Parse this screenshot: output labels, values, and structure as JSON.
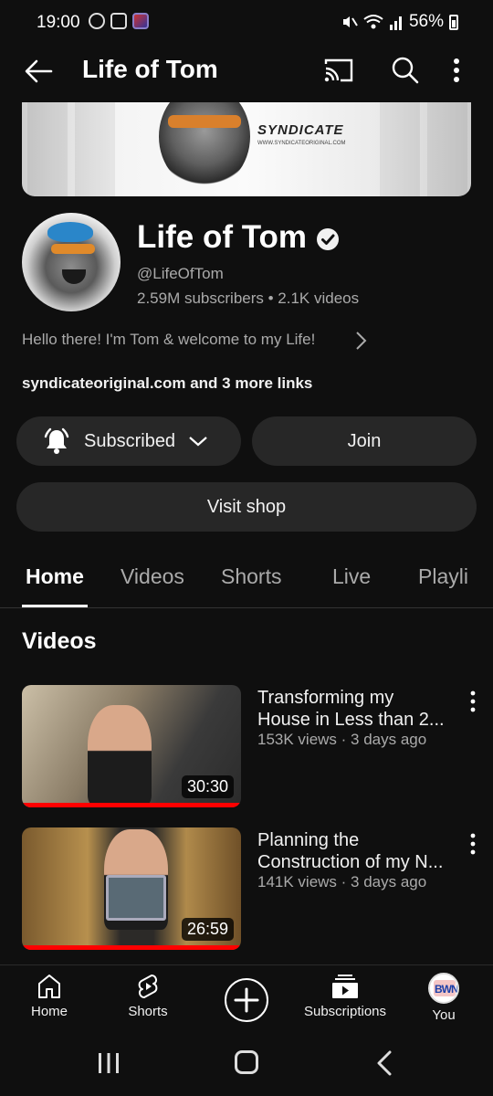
{
  "status_bar": {
    "time": "19:00",
    "battery": "56%",
    "icons": [
      "threads-icon",
      "face-icon",
      "app-icon",
      "mute-icon",
      "wifi-icon",
      "signal-icon",
      "battery-icon"
    ]
  },
  "app_bar": {
    "title": "Life of Tom"
  },
  "banner": {
    "brand": "SYNDICATE",
    "url": "WWW.SYNDICATEORIGINAL.COM"
  },
  "channel": {
    "name": "Life of Tom",
    "handle": "@LifeOfTom",
    "stats": "2.59M subscribers • 2.1K videos",
    "description": "Hello there! I'm Tom & welcome to my Life!",
    "links": "syndicateoriginal.com and 3 more links"
  },
  "buttons": {
    "subscribed": "Subscribed",
    "join": "Join",
    "visit_shop": "Visit shop"
  },
  "tabs": [
    {
      "label": "Home",
      "active": true
    },
    {
      "label": "Videos",
      "active": false
    },
    {
      "label": "Shorts",
      "active": false
    },
    {
      "label": "Live",
      "active": false
    },
    {
      "label": "Playli",
      "active": false
    }
  ],
  "section": {
    "title": "Videos"
  },
  "videos": [
    {
      "title_line1": "Transforming my",
      "title_line2": "House in Less than 2...",
      "meta": "153K views · 3 days ago",
      "duration": "30:30",
      "watched_fraction": 1.0
    },
    {
      "title_line1": "Planning the",
      "title_line2": "Construction of my N...",
      "meta": "141K views · 3 days ago",
      "duration": "26:59",
      "watched_fraction": 1.0
    }
  ],
  "bottom_nav": [
    {
      "label": "Home",
      "icon": "home-icon"
    },
    {
      "label": "Shorts",
      "icon": "shorts-icon"
    },
    {
      "label": "",
      "icon": "create-plus-icon"
    },
    {
      "label": "Subscriptions",
      "icon": "subscriptions-icon"
    },
    {
      "label": "You",
      "icon": "profile-avatar"
    }
  ],
  "colors": {
    "background": "#0f0f0f",
    "pill": "#272727",
    "secondary_text": "#aaaaaa",
    "progress": "#ff0000"
  }
}
